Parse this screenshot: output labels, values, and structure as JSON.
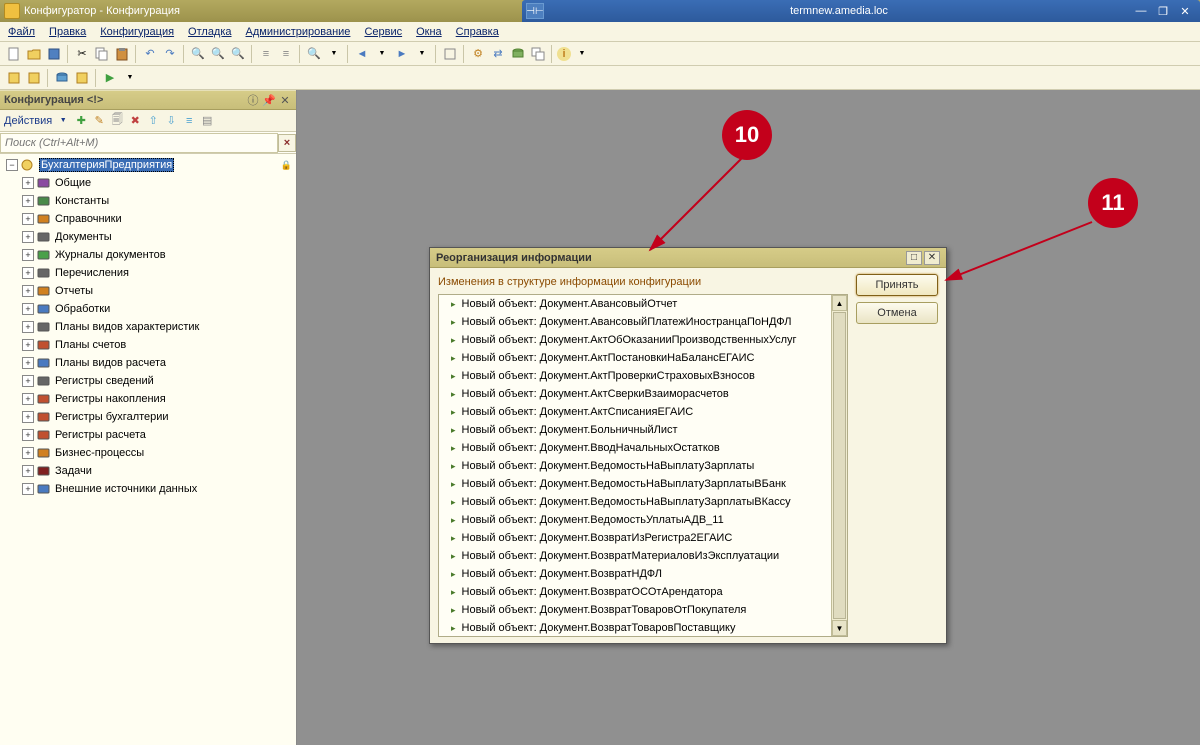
{
  "remote": {
    "title": "termnew.amedia.loc"
  },
  "app": {
    "title": "Конфигуратор - Конфигурация"
  },
  "menu": {
    "file": "Файл",
    "edit": "Правка",
    "config": "Конфигурация",
    "debug": "Отладка",
    "admin": "Администрирование",
    "service": "Сервис",
    "windows": "Окна",
    "help": "Справка"
  },
  "sidepanel": {
    "title": "Конфигурация <!>",
    "actions_label": "Действия ",
    "search_placeholder": "Поиск (Ctrl+Alt+M)",
    "root": "БухгалтерияПредприятия",
    "items": [
      {
        "label": "Общие",
        "icon": "common-icon",
        "color": "#8a4aa0"
      },
      {
        "label": "Константы",
        "icon": "constant-icon",
        "color": "#4a8a4a"
      },
      {
        "label": "Справочники",
        "icon": "catalog-icon",
        "color": "#d08020"
      },
      {
        "label": "Документы",
        "icon": "document-icon",
        "color": "#666666"
      },
      {
        "label": "Журналы документов",
        "icon": "journal-icon",
        "color": "#4aa04a"
      },
      {
        "label": "Перечисления",
        "icon": "enum-icon",
        "color": "#666666"
      },
      {
        "label": "Отчеты",
        "icon": "report-icon",
        "color": "#d08020"
      },
      {
        "label": "Обработки",
        "icon": "processor-icon",
        "color": "#4a7ac0"
      },
      {
        "label": "Планы видов характеристик",
        "icon": "planchar-icon",
        "color": "#666666"
      },
      {
        "label": "Планы счетов",
        "icon": "planacct-icon",
        "color": "#c05030"
      },
      {
        "label": "Планы видов расчета",
        "icon": "plancalc-icon",
        "color": "#4a7ac0"
      },
      {
        "label": "Регистры сведений",
        "icon": "reginfo-icon",
        "color": "#666666"
      },
      {
        "label": "Регистры накопления",
        "icon": "regaccum-icon",
        "color": "#c05030"
      },
      {
        "label": "Регистры бухгалтерии",
        "icon": "regacct-icon",
        "color": "#c05030"
      },
      {
        "label": "Регистры расчета",
        "icon": "regcalc-icon",
        "color": "#c05030"
      },
      {
        "label": "Бизнес-процессы",
        "icon": "bp-icon",
        "color": "#d08020"
      },
      {
        "label": "Задачи",
        "icon": "task-icon",
        "color": "#802020"
      },
      {
        "label": "Внешние источники данных",
        "icon": "extsrc-icon",
        "color": "#4a7ac0"
      }
    ]
  },
  "dialog": {
    "title": "Реорганизация информации",
    "subtitle": "Изменения в структуре информации конфигурации",
    "accept": "Принять",
    "cancel": "Отмена",
    "list_prefix": "Новый объект: ",
    "items": [
      "Документ.АвансовыйОтчет",
      "Документ.АвансовыйПлатежИностранцаПоНДФЛ",
      "Документ.АктОбОказанииПроизводственныхУслуг",
      "Документ.АктПостановкиНаБалансЕГАИС",
      "Документ.АктПроверкиСтраховыхВзносов",
      "Документ.АктСверкиВзаиморасчетов",
      "Документ.АктСписанияЕГАИС",
      "Документ.БольничныйЛист",
      "Документ.ВводНачальныхОстатков",
      "Документ.ВедомостьНаВыплатуЗарплаты",
      "Документ.ВедомостьНаВыплатуЗарплатыВБанк",
      "Документ.ВедомостьНаВыплатуЗарплатыВКассу",
      "Документ.ВедомостьУплатыАДВ_11",
      "Документ.ВозвратИзРегистра2ЕГАИС",
      "Документ.ВозвратМатериаловИзЭксплуатации",
      "Документ.ВозвратНДФЛ",
      "Документ.ВозвратОСОтАрендатора",
      "Документ.ВозвратТоваровОтПокупателя",
      "Документ.ВозвратТоваровПоставщику"
    ]
  },
  "annotations": {
    "b10": "10",
    "b11": "11"
  }
}
